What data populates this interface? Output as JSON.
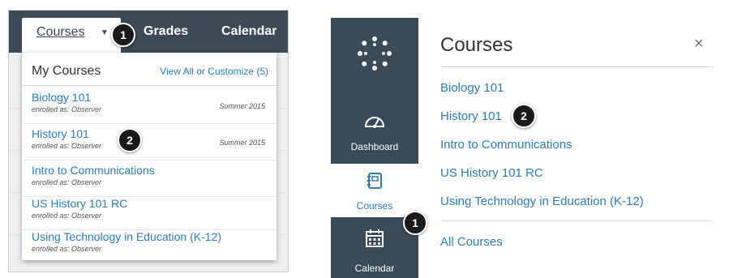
{
  "colors": {
    "nav_bg": "#3c4a57",
    "link": "#2d7ec0",
    "badge": "#1a1a1a"
  },
  "old_ui": {
    "nav": {
      "courses": "Courses",
      "grades": "Grades",
      "calendar": "Calendar"
    },
    "dropdown": {
      "header": "My Courses",
      "view_all": "View All or Customize (5)",
      "items": [
        {
          "name": "Biology 101",
          "role": "enrolled as: Observer",
          "term": "Summer 2015"
        },
        {
          "name": "History 101",
          "role": "enrolled as: Observer",
          "term": "Summer 2015"
        },
        {
          "name": "Intro to Communications",
          "role": "enrolled as: Observer",
          "term": ""
        },
        {
          "name": "US History 101 RC",
          "role": "enrolled as: Observer",
          "term": ""
        },
        {
          "name": "Using Technology in Education (K-12)",
          "role": "enrolled as: Observer",
          "term": ""
        }
      ]
    },
    "badges": {
      "one": "1",
      "two": "2"
    }
  },
  "new_ui": {
    "global_nav": {
      "dashboard": "Dashboard",
      "courses": "Courses",
      "calendar": "Calendar"
    },
    "tray": {
      "title": "Courses",
      "close": "×",
      "links": [
        "Biology 101",
        "History 101",
        "Intro to Communications",
        "US History 101 RC",
        "Using Technology in Education (K-12)"
      ],
      "all_courses": "All Courses"
    },
    "badges": {
      "one": "1",
      "two": "2"
    }
  }
}
